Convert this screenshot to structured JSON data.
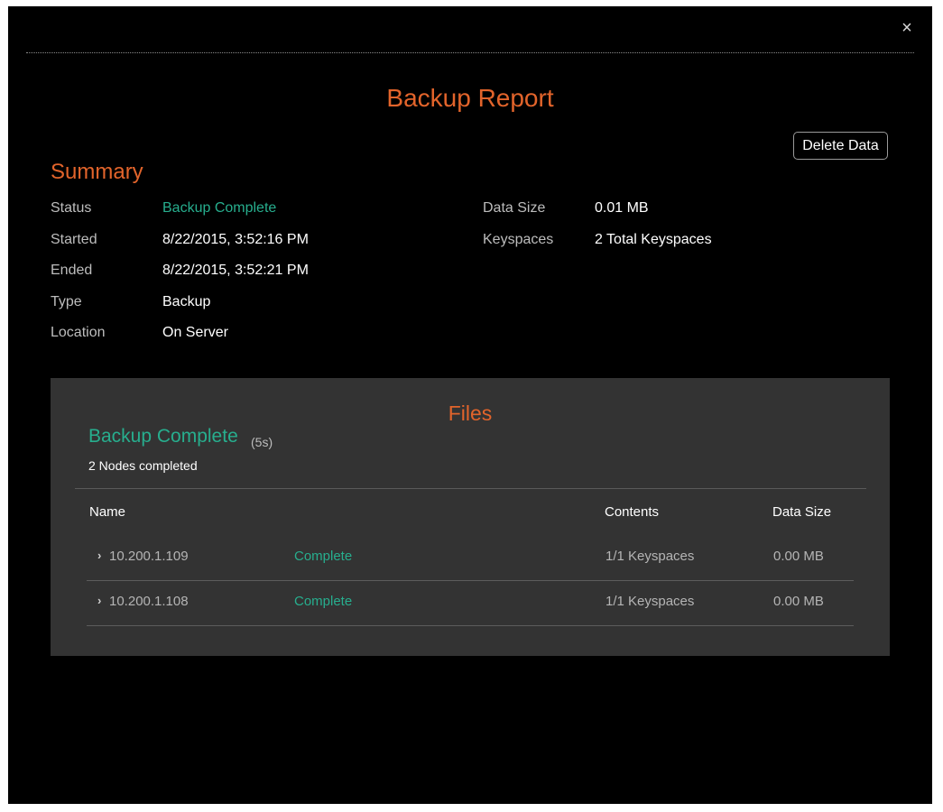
{
  "modal": {
    "close_icon": "×"
  },
  "report": {
    "title": "Backup Report",
    "delete_label": "Delete Data"
  },
  "summary": {
    "heading": "Summary",
    "left_fields": [
      {
        "label": "Status",
        "value": "Backup Complete"
      },
      {
        "label": "Started",
        "value": "8/22/2015, 3:52:16 PM"
      },
      {
        "label": "Ended",
        "value": "8/22/2015, 3:52:21 PM"
      },
      {
        "label": "Type",
        "value": "Backup"
      },
      {
        "label": "Location",
        "value": "On Server"
      }
    ],
    "right_fields": [
      {
        "label": "Data Size",
        "value": "0.01 MB"
      },
      {
        "label": "Keyspaces",
        "value": "2 Total Keyspaces"
      }
    ]
  },
  "files": {
    "title": "Files",
    "status": "Backup Complete",
    "duration": "(5s)",
    "nodes_completed": "2 Nodes completed",
    "columns": {
      "name": "Name",
      "contents": "Contents",
      "data_size": "Data Size"
    },
    "rows": [
      {
        "chevron": "›",
        "name": "10.200.1.109",
        "status": "Complete",
        "contents": "1/1 Keyspaces",
        "data_size": "0.00 MB"
      },
      {
        "chevron": "›",
        "name": "10.200.1.108",
        "status": "Complete",
        "contents": "1/1 Keyspaces",
        "data_size": "0.00 MB"
      }
    ]
  },
  "colors": {
    "accent_orange": "#e2642b",
    "status_green": "#27ae8e",
    "background": "#000000",
    "panel": "#333333"
  }
}
